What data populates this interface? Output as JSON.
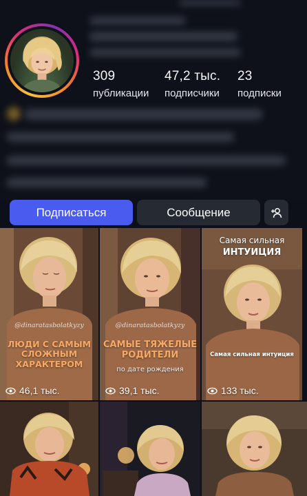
{
  "profile": {
    "stats": [
      {
        "value": "309",
        "label": "публикации"
      },
      {
        "value": "47,2 тыс.",
        "label": "подписчики"
      },
      {
        "value": "23",
        "label": "подписки"
      }
    ]
  },
  "actions": {
    "follow_label": "Подписаться",
    "message_label": "Сообщение",
    "add_user_icon": "add-user-icon"
  },
  "colors": {
    "follow_button": "#4a5cf0",
    "secondary_button": "#262a33",
    "background": "#0d1018",
    "accent_caption": "#f6a865"
  },
  "posts": [
    {
      "handle": "@dinaratasbolatkyzy",
      "caption": [
        "ЛЮДИ С САМЫМ",
        "СЛОЖНЫМ ХАРАКТЕРОМ"
      ],
      "views": "46,1 тыс."
    },
    {
      "handle": "@dinaratasbolatkyzy",
      "caption": [
        "САМЫЕ ТЯЖЕЛЫЕ",
        "РОДИТЕЛИ"
      ],
      "subcaption": "по дате рождения",
      "views": "39,1 тыс."
    },
    {
      "top_caption": [
        "Самая сильная",
        "ИНТУИЦИЯ"
      ],
      "caption": [
        "Самая сильная интуиция"
      ],
      "views": "133 тыс."
    },
    {},
    {},
    {}
  ]
}
